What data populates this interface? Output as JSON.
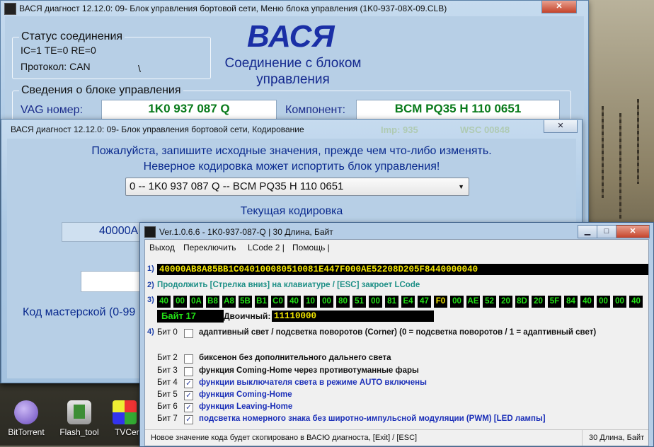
{
  "desktop": {
    "icons": [
      {
        "label": "BitTorrent",
        "color": "#6a4bbd"
      },
      {
        "label": "Flash_tool",
        "color": "#4a9a3a"
      },
      {
        "label": "TVCer",
        "color": "#d8d8d8"
      }
    ]
  },
  "main_window": {
    "title": "ВАСЯ диагност 12.12.0: 09- Блок управления бортовой сети,   Меню блока управления (1K0-937-08X-09.CLB)",
    "close_glyph": "✕",
    "logo": "ВАСЯ",
    "subtitle_line1": "Соединение с блоком",
    "subtitle_line2": "управления",
    "status_group": {
      "title": "Статус соединения",
      "ic_line": "IC=1  TE=0   RE=0",
      "protocol": "Протокол: CAN",
      "spinner": "\\"
    },
    "info_group": {
      "title": "Сведения о блоке управления",
      "vag_label": "VAG номер:",
      "vag_value": "1K0 937 087 Q",
      "component_label": "Компонент:",
      "component_value": "BCM PQ35  H    110 0651",
      "hidden_right1": "Imp: 935",
      "hidden_right2": "WSC 00848"
    }
  },
  "coding_window": {
    "title": "ВАСЯ диагност 12.12.0: 09-  Блок управления бортовой сети,  Кодирование",
    "close_glyph": "✕",
    "warning_line1": "Пожалуйста, запишите исходные значения, прежде чем что-либо изменять.",
    "warning_line2": "Неверное кодировка может испортить блок управления!",
    "combo_value": "0 -- 1K0 937 087 Q -- BCM PQ35  H    110 0651",
    "combo_arrow": "▼",
    "current_coding_label": "Текущая кодировка",
    "current_coding_value": "40000A",
    "workshop_label": "Код мастерской (0-99"
  },
  "lcode_window": {
    "title": "Ver.1.0.6.6 -   1K0-937-087-Q | 30 Длина, Байт",
    "min_glyph": "▁",
    "max_glyph": "□",
    "close_glyph": "✕",
    "menu": [
      "Выход",
      "Переключить",
      "LCode 2 |",
      "Помощь |"
    ],
    "row1_num": "1)",
    "coding_string": "40000AB8A85BB1C040100080510081E447F000AE52208D205F8440000040",
    "row2_num": "2)",
    "hint": "Продолжить [Стрелка вниз] на клавиатуре / [ESC] закроет LCode",
    "row3_num": "3)",
    "bytes": [
      "40",
      "00",
      "0A",
      "B8",
      "A8",
      "5B",
      "B1",
      "C0",
      "40",
      "10",
      "00",
      "80",
      "51",
      "00",
      "81",
      "E4",
      "47",
      "F0",
      "00",
      "AE",
      "52",
      "20",
      "8D",
      "20",
      "5F",
      "84",
      "40",
      "00",
      "00",
      "40"
    ],
    "selected_byte_index": 17,
    "byte_label": "Байт 17",
    "binary_label": "Двоичный:",
    "binary_value": "11110000",
    "row4_num": "4)",
    "bits": [
      {
        "label": "Бит 0",
        "checked": false,
        "text": "адаптивный свет / подсветка поворотов (Corner) (0 = подсветка поворотов / 1 = адаптивный свет)",
        "color": "#111111"
      },
      {
        "label": "Бит 2",
        "checked": false,
        "text": "биксенон без дополнительного дальнего света",
        "color": "#111111"
      },
      {
        "label": "Бит 3",
        "checked": false,
        "text": "функция Coming-Home через противотуманные фары",
        "color": "#111111"
      },
      {
        "label": "Бит 4",
        "checked": true,
        "text": "функции выключателя света в режиме AUTO включены",
        "color": "#1b2fb8"
      },
      {
        "label": "Бит 5",
        "checked": true,
        "text": "функция Coming-Home",
        "color": "#1b2fb8"
      },
      {
        "label": "Бит 6",
        "checked": true,
        "text": "функция Leaving-Home",
        "color": "#1b2fb8"
      },
      {
        "label": "Бит 7",
        "checked": true,
        "text": "подсветка номерного знака без широтно-импульсной модуляции (PWM) [LED лампы]",
        "color": "#1b2fb8"
      }
    ],
    "check_glyph": "✓",
    "status_left": "Новое значение кода будет скопировано в ВАСЮ диагноста, [Exit] / [ESC]",
    "status_right": "30 Длина, Байт"
  }
}
